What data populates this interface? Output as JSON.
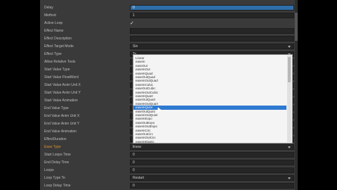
{
  "colors": {
    "panel_bg": "#3a3a3a",
    "field_bg": "#262626",
    "selected_field": "#2f6ea8",
    "highlight_label": "#e0912d",
    "dropdown_bg": "#f4f4f4",
    "dropdown_selected": "#2e7ad1"
  },
  "rows": [
    {
      "label": "Delay",
      "kind": "text",
      "value": "0"
    },
    {
      "label": "Method",
      "kind": "text",
      "value": "1"
    },
    {
      "label": "Active Loop",
      "kind": "check",
      "value": "✓"
    },
    {
      "label": "Effect Name",
      "kind": "text",
      "value": ""
    },
    {
      "label": "Effect Description",
      "kind": "text",
      "value": ""
    },
    {
      "label": "Effect Target Mode",
      "kind": "select",
      "value": "Sin"
    },
    {
      "label": "Effect Type",
      "kind": "select",
      "value": "To"
    },
    {
      "label": "Allow Relative Tools",
      "kind": "text",
      "value": ""
    },
    {
      "label": "Start Value Type",
      "kind": "text",
      "value": ""
    },
    {
      "label": "Start Value FloatWord",
      "kind": "text",
      "value": ""
    },
    {
      "label": "Start Value Anim Unit X",
      "kind": "text",
      "value": ""
    },
    {
      "label": "Start Value Anim Unit Y",
      "kind": "text",
      "value": ""
    },
    {
      "label": "Start Value Animation",
      "kind": "text",
      "value": ""
    },
    {
      "label": "End Value Type",
      "kind": "text",
      "value": ""
    },
    {
      "label": "End Value Anim Unit X",
      "kind": "text",
      "value": ""
    },
    {
      "label": "End Value Anim Unit Y",
      "kind": "text",
      "value": ""
    },
    {
      "label": "End Value Animation",
      "kind": "text",
      "value": ""
    },
    {
      "label": "EffectDuration",
      "kind": "text",
      "value": ""
    },
    {
      "label": "Ease Type",
      "kind": "select",
      "value": "linear",
      "highlight": true
    },
    {
      "label": "Start Loops Time",
      "kind": "text",
      "value": "0"
    },
    {
      "label": "End Delay Time",
      "kind": "text",
      "value": "0"
    },
    {
      "label": "Loops",
      "kind": "text",
      "value": "0"
    },
    {
      "label": "Loop Type To",
      "kind": "select",
      "value": "Restart"
    },
    {
      "label": "Loop Delay Time",
      "kind": "text",
      "value": "0"
    }
  ],
  "dropdown": {
    "options": [
      "Linear",
      "easeIn",
      "easeOut",
      "easeInOut",
      "easeInQuad",
      "easeOutQuad",
      "easeInOutQuad",
      "easeInCubic",
      "easeOutCubic",
      "easeInOutCubic",
      "easeInQuart",
      "easeOutQuart",
      "easeInOutQuart",
      "easeInQuint",
      "easeOutQuint",
      "easeInOutQuint",
      "easeInExpo",
      "easeOutExpo",
      "easeInOutExpo",
      "easeInCirc",
      "easeOutCirc",
      "easeInOutCirc",
      "easeInElastic"
    ],
    "selected_index": 13
  }
}
